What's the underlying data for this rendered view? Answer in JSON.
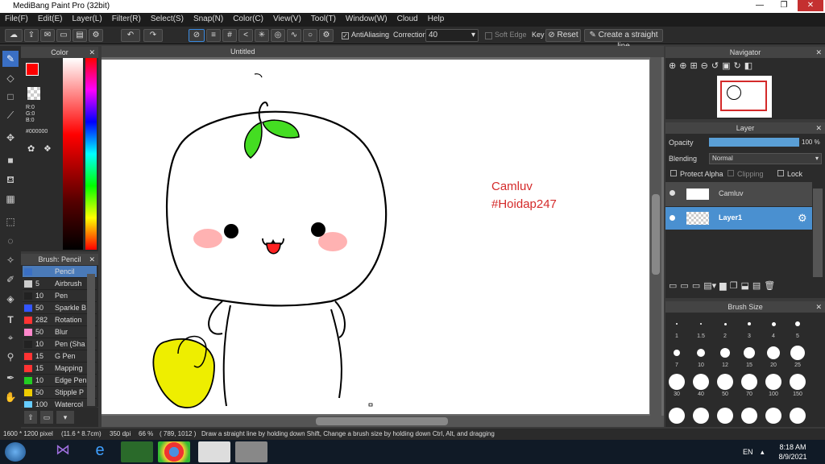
{
  "window": {
    "title": "MediBang Paint Pro (32bit)",
    "min": "—",
    "max": "❐",
    "close": "✕"
  },
  "menu": [
    "File(F)",
    "Edit(E)",
    "Layer(L)",
    "Filter(R)",
    "Select(S)",
    "Snap(N)",
    "Color(C)",
    "View(V)",
    "Tool(T)",
    "Window(W)",
    "Cloud",
    "Help"
  ],
  "toolbar": {
    "antialiasing": "AntiAliasing",
    "correction_label": "Correction",
    "correction_value": "40",
    "soft_edge": "Soft Edge",
    "key": "Key",
    "reset": "Reset",
    "straight_line": "Create a straight line"
  },
  "color_panel": {
    "title": "Color",
    "r": "R:0",
    "g": "G:0",
    "b": "B:0",
    "hex": "#000000",
    "fg": "#ff0000"
  },
  "brush_panel": {
    "title": "Brush: Pencil",
    "items": [
      {
        "size": "",
        "name": "Pencil",
        "color": "#3a6fc4"
      },
      {
        "size": "5",
        "name": "Airbrush",
        "color": "#cccccc"
      },
      {
        "size": "10",
        "name": "Pen",
        "color": "#222222"
      },
      {
        "size": "50",
        "name": "Sparkle B",
        "color": "#3355ff"
      },
      {
        "size": "282",
        "name": "Rotation",
        "color": "#ff3333"
      },
      {
        "size": "50",
        "name": "Blur",
        "color": "#ff88cc"
      },
      {
        "size": "10",
        "name": "Pen (Sha",
        "color": "#222222"
      },
      {
        "size": "15",
        "name": "G Pen",
        "color": "#ff3333"
      },
      {
        "size": "15",
        "name": "Mapping",
        "color": "#ff3333"
      },
      {
        "size": "10",
        "name": "Edge Pen",
        "color": "#22cc22"
      },
      {
        "size": "50",
        "name": "Stipple P",
        "color": "#eecc00"
      },
      {
        "size": "100",
        "name": "Watercol",
        "color": "#66ccff"
      }
    ]
  },
  "canvas": {
    "tab": "Untitled",
    "text1": "Camluv",
    "text2": "#Hoidap247"
  },
  "navigator": {
    "title": "Navigator"
  },
  "layer_panel": {
    "title": "Layer",
    "opacity_label": "Opacity",
    "opacity_value": "100 %",
    "opacity_fraction": 1.0,
    "blending_label": "Blending",
    "blending_value": "Normal",
    "protect_alpha": "Protect Alpha",
    "clipping": "Clipping",
    "lock": "Lock",
    "layers": [
      {
        "name": "Camluv",
        "selected": false
      },
      {
        "name": "Layer1",
        "selected": true
      }
    ]
  },
  "brush_size": {
    "title": "Brush Size",
    "row1": [
      "1",
      "1.5",
      "2",
      "3",
      "4",
      "5"
    ],
    "row2": [
      "7",
      "10",
      "12",
      "15",
      "20",
      "25"
    ],
    "row3": [
      "30",
      "40",
      "50",
      "70",
      "100",
      "150"
    ]
  },
  "status": {
    "size": "1600 * 1200 pixel",
    "cm": "(11.6 * 8.7cm)",
    "dpi": "350 dpi",
    "zoom": "66 %",
    "coords": "( 789, 1012 )",
    "hint": "Draw a straight line by holding down Shift, Change a brush size by holding down Ctrl, Alt, and dragging"
  },
  "taskbar": {
    "lang": "EN",
    "time": "8:18 AM",
    "date": "8/9/2021"
  }
}
